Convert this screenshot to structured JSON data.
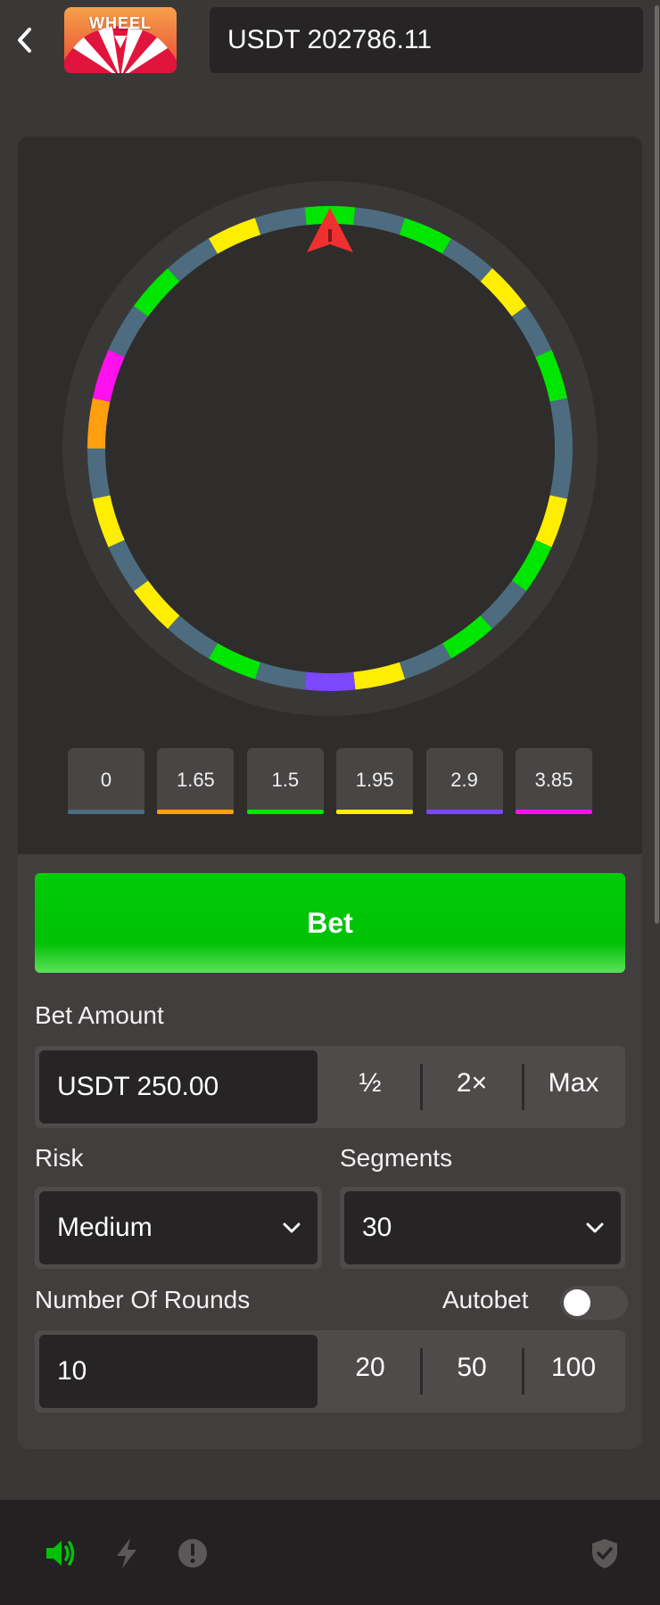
{
  "header": {
    "logo_text": "WHEEL",
    "balance": "USDT 202786.11"
  },
  "wheel": {
    "segment_colors": [
      "#00e600",
      "#4d6c80",
      "#00e600",
      "#4d6c80",
      "#ffee00",
      "#4d6c80",
      "#00e600",
      "#4d6c80",
      "#4d6c80",
      "#ffee00",
      "#00e600",
      "#4d6c80",
      "#00e600",
      "#4d6c80",
      "#ffee00",
      "#7b47ff",
      "#4d6c80",
      "#00e600",
      "#4d6c80",
      "#ffee00",
      "#4d6c80",
      "#ffee00",
      "#4d6c80",
      "#ff9f10",
      "#ff10ef",
      "#4d6c80",
      "#00e600",
      "#4d6c80",
      "#ffee00",
      "#4d6c80"
    ]
  },
  "multipliers": [
    {
      "label": "0",
      "color": "#4d6c80"
    },
    {
      "label": "1.65",
      "color": "#ff9f10"
    },
    {
      "label": "1.5",
      "color": "#00e600"
    },
    {
      "label": "1.95",
      "color": "#ffee00"
    },
    {
      "label": "2.9",
      "color": "#7b47ff"
    },
    {
      "label": "3.85",
      "color": "#ff10ef"
    }
  ],
  "bet_button": "Bet",
  "bet_amount": {
    "label": "Bet Amount",
    "value": "USDT 250.00",
    "half": "½",
    "double": "2×",
    "max": "Max"
  },
  "risk": {
    "label": "Risk",
    "value": "Medium"
  },
  "segments": {
    "label": "Segments",
    "value": "30"
  },
  "rounds": {
    "label": "Number Of Rounds",
    "value": "10",
    "opt1": "20",
    "opt2": "50",
    "opt3": "100"
  },
  "autobet": {
    "label": "Autobet",
    "enabled": false
  },
  "colors": {
    "accent_green": "#00c106",
    "pointer_red": "#f03030"
  }
}
